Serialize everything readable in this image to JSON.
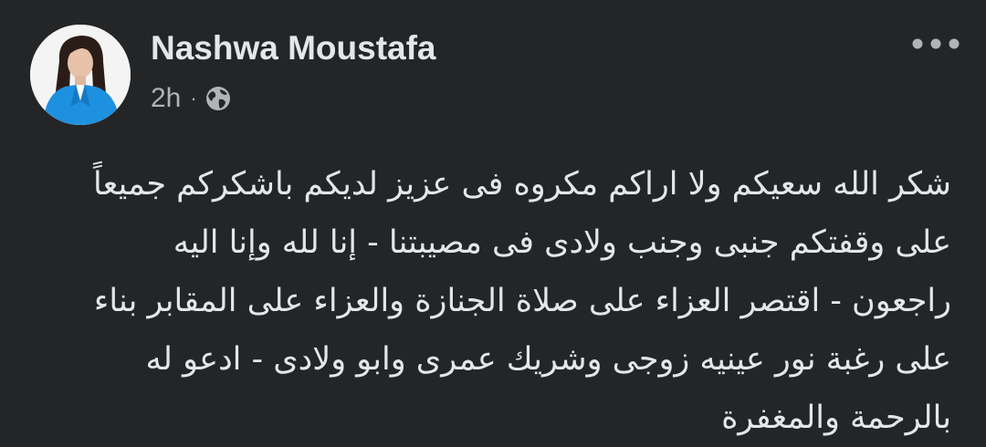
{
  "post": {
    "author": "Nashwa Moustafa",
    "timestamp": "2h",
    "separator": "·",
    "audience_icon": "globe-icon",
    "more_icon": "more-options-icon",
    "avatar_icon": "profile-photo",
    "text_lines": [
      "شكر الله سعيكم ولا اراكم مكروه فى عزيز لديكم باشكركم جميعاً",
      "على وقفتكم جنبى وجنب ولادى فى مصيبتنا -  إنا لله وإنا اليه",
      "راجعون - اقتصر العزاء على صلاة الجنازة والعزاء على المقابر بناء",
      "على رغبة نور عينيه زوجى وشريك عمرى وابو ولادى -  ادعو له",
      "بالرحمة والمغفرة"
    ]
  },
  "colors": {
    "background": "#242526",
    "primary_text": "#e4e6eb",
    "secondary_text": "#b0b3b8",
    "blazer_blue": "#1e90e0"
  }
}
